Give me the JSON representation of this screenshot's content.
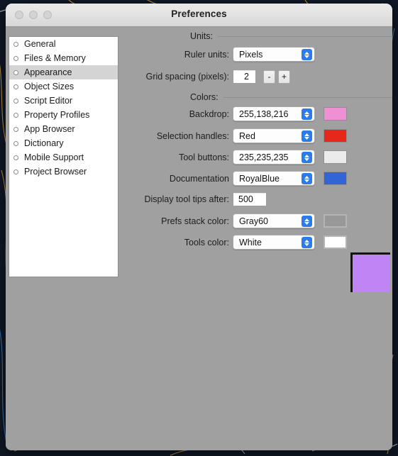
{
  "window": {
    "title": "Preferences",
    "traffic_lights": [
      "close",
      "minimize",
      "zoom"
    ]
  },
  "sidebar": {
    "items": [
      {
        "label": "General",
        "selected": false
      },
      {
        "label": "Files & Memory",
        "selected": false
      },
      {
        "label": "Appearance",
        "selected": true
      },
      {
        "label": "Object Sizes",
        "selected": false
      },
      {
        "label": "Script Editor",
        "selected": false
      },
      {
        "label": "Property Profiles",
        "selected": false
      },
      {
        "label": "App Browser",
        "selected": false
      },
      {
        "label": "Dictionary",
        "selected": false
      },
      {
        "label": "Mobile Support",
        "selected": false
      },
      {
        "label": "Project Browser",
        "selected": false
      }
    ]
  },
  "sections": {
    "units": "Units:",
    "colors": "Colors:"
  },
  "fields": {
    "ruler_units": {
      "label": "Ruler units:",
      "value": "Pixels"
    },
    "grid_spacing": {
      "label": "Grid spacing (pixels):",
      "value": "2",
      "minus": "-",
      "plus": "+"
    },
    "backdrop": {
      "label": "Backdrop:",
      "value": "255,138,216",
      "color": "#ef8fd4"
    },
    "selection_handles": {
      "label": "Selection handles:",
      "value": "Red",
      "color": "#e8271b"
    },
    "tool_buttons": {
      "label": "Tool buttons:",
      "value": "235,235,235",
      "color": "#ebebeb"
    },
    "documentation": {
      "label": "Documentation",
      "value": "RoyalBlue",
      "color": "#3364d6"
    },
    "tool_tips": {
      "label": "Display tool tips after:",
      "value": "500"
    },
    "prefs_stack_color": {
      "label": "Prefs stack color:",
      "value": "Gray60",
      "color": "#989898"
    },
    "tools_color": {
      "label": "Tools color:",
      "value": "White",
      "color": "#ffffff"
    }
  },
  "preview": {
    "color": "#c084f5"
  }
}
